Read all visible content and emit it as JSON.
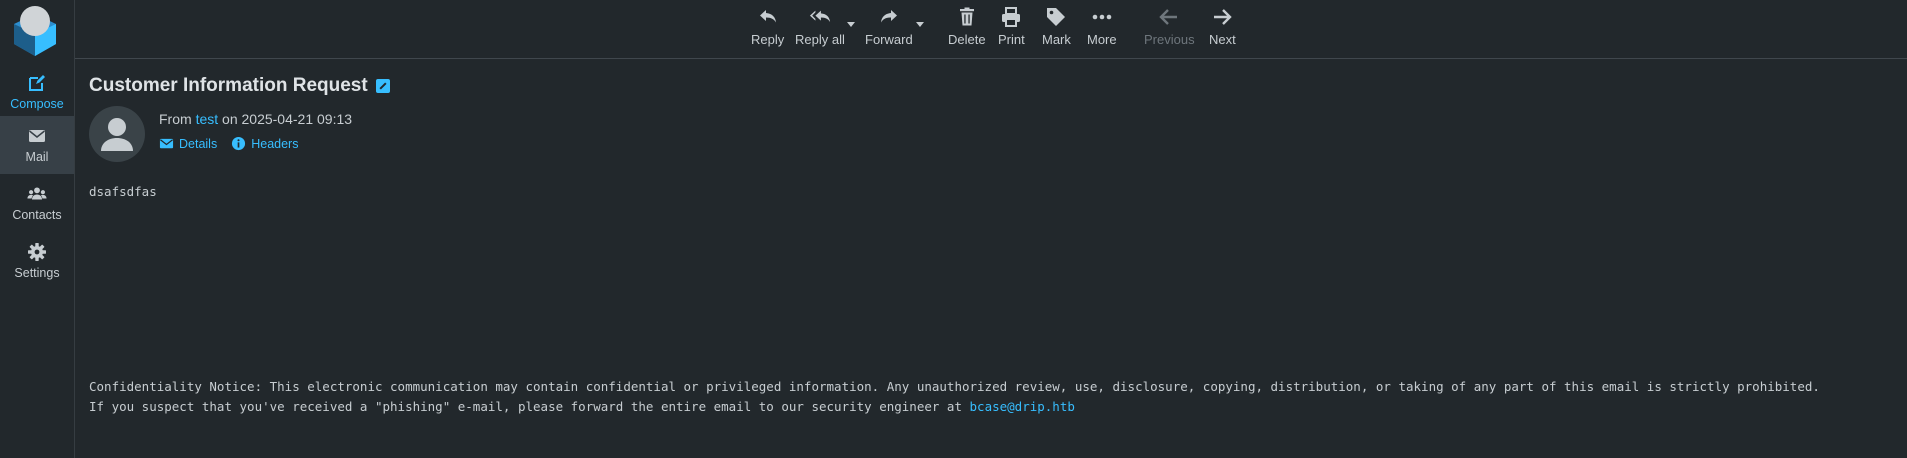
{
  "nav": {
    "compose": "Compose",
    "mail": "Mail",
    "contacts": "Contacts",
    "settings": "Settings"
  },
  "toolbar": {
    "reply": "Reply",
    "reply_all": "Reply all",
    "forward": "Forward",
    "delete": "Delete",
    "print": "Print",
    "mark": "Mark",
    "more": "More",
    "previous": "Previous",
    "next": "Next"
  },
  "message": {
    "subject": "Customer Information Request",
    "from_prefix": "From",
    "sender": "test",
    "date_prefix": "on",
    "date": "2025-04-21 09:13",
    "details": "Details",
    "headers": "Headers",
    "body": "dsafsdfas",
    "notice_line1": "Confidentiality Notice: This electronic communication may contain confidential or privileged information. Any unauthorized review, use, disclosure, copying, distribution, or taking of any part of this email is strictly prohibited.",
    "notice_line2": "If you suspect that you've received a \"phishing\" e-mail, please forward the entire email to our security engineer at",
    "security_email": "bcase@drip.htb"
  },
  "colors": {
    "accent": "#37beff",
    "background": "#22282c",
    "active_nav": "#374047"
  }
}
